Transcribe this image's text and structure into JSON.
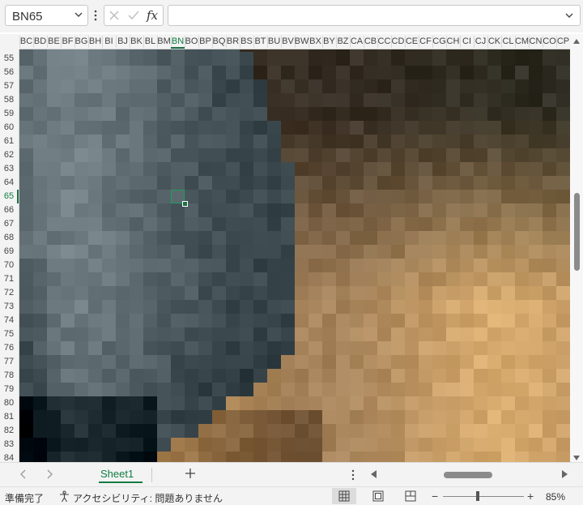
{
  "name_box": {
    "value": "BN65"
  },
  "formula_bar": {
    "cancel_icon": "x-icon",
    "confirm_icon": "check-icon",
    "function_label": "fx",
    "value": ""
  },
  "columns": [
    "BC",
    "BD",
    "BE",
    "BF",
    "BG",
    "BH",
    "BI",
    "BJ",
    "BK",
    "BL",
    "BM",
    "BN",
    "BO",
    "BP",
    "BQ",
    "BR",
    "BS",
    "BT",
    "BU",
    "BV",
    "BW",
    "BX",
    "BY",
    "BZ",
    "CA",
    "CB",
    "CC",
    "CD",
    "CE",
    "CF",
    "CG",
    "CH",
    "CI",
    "CJ",
    "CK",
    "CL",
    "CM",
    "CN",
    "CO",
    "CP"
  ],
  "rows": [
    "55",
    "56",
    "57",
    "58",
    "59",
    "60",
    "61",
    "62",
    "63",
    "64",
    "65",
    "66",
    "67",
    "68",
    "69",
    "70",
    "71",
    "72",
    "73",
    "74",
    "75",
    "76",
    "77",
    "78",
    "79",
    "80",
    "81",
    "82",
    "83",
    "84"
  ],
  "active_cell": {
    "column": "BN",
    "row": "65"
  },
  "sheets": [
    {
      "label": "Sheet1",
      "active": true
    }
  ],
  "status": {
    "ready": "準備完了",
    "accessibility": "アクセシビリティ: 問題ありません"
  },
  "zoom": {
    "label": "85%",
    "percent": 85
  },
  "icons": [
    "chevron-down-icon",
    "more-vertical-icon",
    "x-icon",
    "check-icon",
    "fx-icon",
    "chevron-left-icon",
    "chevron-right-icon",
    "plus-icon",
    "accessibility-icon",
    "normal-view-icon",
    "page-layout-icon",
    "page-break-icon"
  ],
  "colors": {
    "accent_green": "#107c41",
    "active_cell_border": "#1e9e5a",
    "header_bg": "#f3f3f3"
  }
}
